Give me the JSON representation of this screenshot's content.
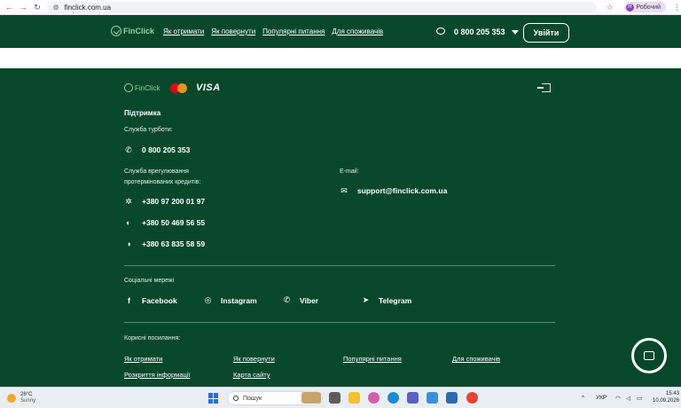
{
  "browser": {
    "url": "finclick.com.ua",
    "profile_initial": "Я",
    "profile_label": "Робочий"
  },
  "header": {
    "logo": "FinClick",
    "menu": [
      "Як отримати",
      "Як повернути",
      "Популярні питання",
      "Для споживачів"
    ],
    "phone": "0 800 205 353",
    "login_label": "Увійти"
  },
  "footer": {
    "logo": "FinClick",
    "card_brand": "VISA",
    "support_title": "Підтримка",
    "hotline_label": "Служба турботи:",
    "hotline_phone": "0 800 205 353",
    "settlement_label": "Служба врегулювання протермінованих кредитів:",
    "phones": [
      "+380 97 200 01 97",
      "+380 50 469 56 55",
      "+380 63 835 58 59"
    ],
    "email_label": "E-mail:",
    "email": "support@finclick.com.ua",
    "social_title": "Соціальні мережі",
    "social": [
      "Facebook",
      "Instagram",
      "Viber",
      "Telegram"
    ],
    "links_title": "Корисні посилання:",
    "links": [
      "Як отримати",
      "Як повернути",
      "Популярні питання",
      "Для споживачів",
      "Розкриття інформації",
      "Карта сайту"
    ]
  },
  "taskbar": {
    "temp": "28°C",
    "condition": "Sunny",
    "search_placeholder": "Пошук",
    "lang": "УКР",
    "time": "15:43",
    "date": "10.09.2026"
  },
  "colors": {
    "brand_green": "#07482b",
    "logo_green": "#8fd3a5"
  }
}
